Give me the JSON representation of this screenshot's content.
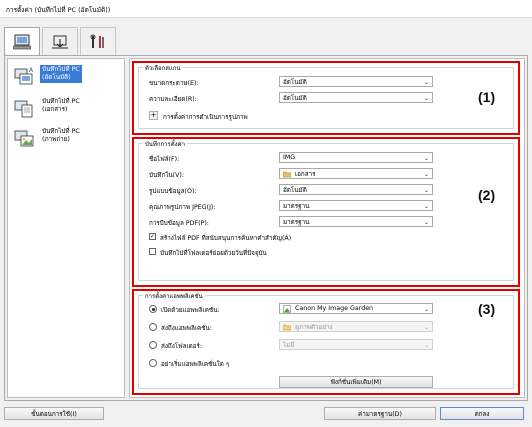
{
  "window": {
    "title": "การตั้งค่า (บันทึกไปที่ PC (อัตโนมัติ))"
  },
  "tabs": [
    {
      "icon": "computer-scan-icon"
    },
    {
      "icon": "scanner-icon"
    },
    {
      "icon": "tools-icon"
    }
  ],
  "sidebar": {
    "items": [
      {
        "label_line1": "บันทึกไปที่ PC",
        "label_line2": "(อัตโนมัติ)",
        "icon": "auto-save-icon",
        "selected": true
      },
      {
        "label_line1": "บันทึกไปที่ PC",
        "label_line2": "(เอกสาร)",
        "icon": "document-save-icon",
        "selected": false
      },
      {
        "label_line1": "บันทึกไปที่ PC",
        "label_line2": "(ภาพถ่าย)",
        "icon": "photo-save-icon",
        "selected": false
      }
    ]
  },
  "group1": {
    "title": "ตัวเลือกสแกน",
    "number": "(1)",
    "rows": [
      {
        "label": "ขนาดกระดาษ(E):",
        "value": "อัตโนมัติ"
      },
      {
        "label": "ความละเอียด(R):",
        "value": "อัตโนมัติ"
      }
    ],
    "expand_label": "การตั้งค่าการดำเนินการรูปภาพ"
  },
  "group2": {
    "title": "บันทึกการตั้งค่า",
    "number": "(2)",
    "rows": [
      {
        "label": "ชื่อไฟล์(F):",
        "value": "IMG"
      },
      {
        "label": "บันทึกใน(V):",
        "value": "เอกสาร"
      },
      {
        "label": "รูปแบบข้อมูล(O):",
        "value": "อัตโนมัติ"
      },
      {
        "label": "คุณภาพรูปภาพ JPEG(J):",
        "value": "มาตรฐาน"
      },
      {
        "label": "การบีบข้อมูล PDF(P):",
        "value": "มาตรฐาน"
      }
    ],
    "check1": {
      "label": "สร้างไฟล์ PDF ที่สนับสนุนการค้นหาคำสำคัญ(A)",
      "checked": true
    },
    "check2": {
      "label": "บันทึกไปที่โฟลเดอร์ย่อยด้วยวันที่ปัจจุบัน",
      "checked": false
    }
  },
  "group3": {
    "title": "การตั้งค่าแอพพลิเคชั่น",
    "number": "(3)",
    "radios": [
      {
        "label": "เปิดด้วยแอพพลิเคชั่น:",
        "value": "Canon My Image Garden",
        "checked": true,
        "enabled": true
      },
      {
        "label": "ส่งถึงแอพพลิเคชั่น:",
        "value": "ดูภาพตัวอย่าง",
        "checked": false,
        "enabled": false
      },
      {
        "label": "ส่งถึงโฟลเดอร์:",
        "value": "ไม่มี",
        "checked": false,
        "enabled": false
      },
      {
        "label": "อย่าเริ่มแอพพลิเคชั่นใด ๆ",
        "value": "",
        "checked": false,
        "enabled": false
      }
    ],
    "more_button": "ฟังก์ชั่นเพิ่มเติม(M)"
  },
  "footer": {
    "instructions": "ขั้นตอนการใช้(I)",
    "defaults": "ค่ามาตรฐาน(D)",
    "ok": "ตกลง"
  },
  "colors": {
    "highlight": "#e10000",
    "selection": "#3a7bd5"
  }
}
